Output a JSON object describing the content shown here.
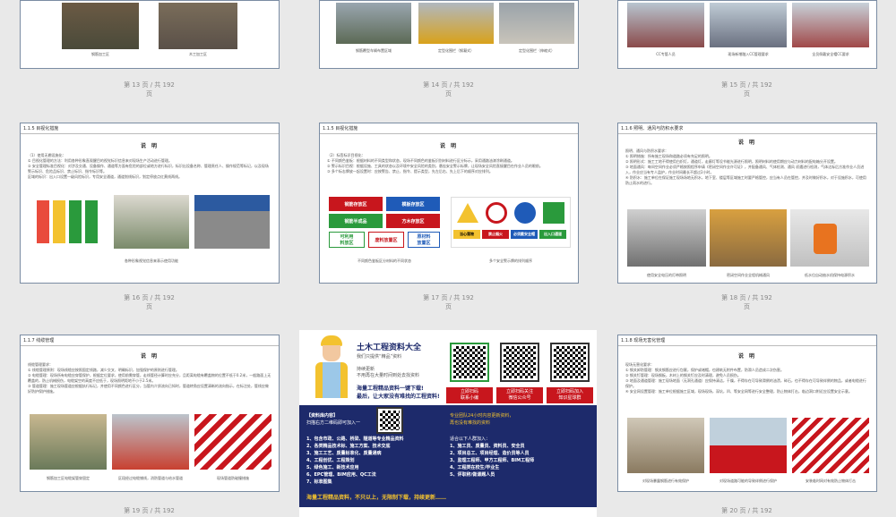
{
  "pages": {
    "p13": {
      "num": "第 13 页 / 共 192",
      "num2": "页",
      "cap1": "钢筋加工区",
      "cap2": "木工加工区"
    },
    "p14": {
      "num": "第 14 页 / 共 192",
      "num2": "页",
      "cap1": "钢筋覆型车辆布置区域",
      "cap2": "定型化围栏（钢凝式）",
      "cap3": "定型化围栏（伸缩式）"
    },
    "p15": {
      "num": "第 15 页 / 共 192",
      "num2": "页",
      "cap1": "CC专管人员",
      "cap2": "现场新增融入CC管理要求",
      "cap3": "全员佩戴安全帽CC要求"
    },
    "p16": {
      "num": "第 16 页 / 共 192",
      "num2": "页",
      "section": "1.1.5  目视化措施",
      "title": "说  明",
      "lines": [
        "（1）使用无棚设施化：",
        "① 目视化管理的方法：利用各种形象直观醒目的视觉标识信息来对现场生产活动进行管理。",
        "② 安全管理标准目视化：对涉及交通、设备操作、通道等方面有危险的部位或地方进行标识，标识出设备名称、管理责任人、操作规范等标记，以及现场警示标识、危险品标识、禁止标识、指令标识等。",
        "区域的标识：出入口设置一级风险标识，专用安全通道，通道划线标识，划定停放点红黄线两线。"
      ],
      "cap1": "各种形象视觉信息来表示使用功能"
    },
    "p17": {
      "num": "第 17 页 / 共 192",
      "num2": "页",
      "section": "1.1.5  目视化措施",
      "title": "说  明",
      "lines": [
        "（2）标签标识目视化：",
        "① 不同颜色鉴板：根据材料的不同类型和状态，现场不同颜色的鉴板识别材料进行区分标示，采用通路油漆涂刷通道。",
        "② 警示标识目视：根据设施、工具的状态以及环境中安全风险的类别，悬挂安全警示标牌，让现场安全风险直接醒目在作业人员的眼前。",
        "③ 多个标志牌放一起设置时：应按警告、禁止、指令、提示类型，先左后右、先上后下的顺序对应排列。"
      ],
      "board": [
        "钢筋存放区",
        "模板存放区",
        "钢筋半成品",
        "方木存放区"
      ],
      "boardSub": [
        "可利用\n料放区",
        "废料放置区",
        "原材料\n放置区"
      ],
      "warn": [
        "当心落物",
        "禁止烟火",
        "必须戴安全帽",
        "出入口通道"
      ],
      "cap1": "不同颜色鉴板区分材料的不同状态",
      "cap2": "多个安全警示牌的排列顺序"
    },
    "p18": {
      "num": "第 18 页 / 共 192",
      "num2": "页",
      "section": "1.1.6  照明、通风与防积水要求",
      "title": "说  明",
      "lines": [
        "照明、通风与防积水要求：",
        "① 照明措施：所有施工现场和道路必须有充足的照明。",
        "② 照明形式：施工工地不得使用白炽灯，通道灯，走廊灯等设节能光源进行照明，照明材料的使用期应与动力材料的配电箱分开设置。",
        "③ 地面通风：每间空间作业必须严格按照程序申请《密闭空间作业许可证》，并配备通风、气体检测、通风 初遇进行检测，气体达标后方准作业人员进入，作业应当有专人监护，作业时间最长不超过2小时。",
        "④ 防积水：施工单位在保证施工现场场地无积水，地下室、楼层等区域施工时要严格管控，应当有人员在管控，并及时做好积水，对于设施积水，可使用防止雨水的进行。"
      ],
      "cap1": "使用安全电压的灯带照明",
      "cap2": "密闭空间作业全程机械通风",
      "cap3": "低水位自动抽水机保持电源积水"
    },
    "p19": {
      "num": "第 19 页 / 共 192",
      "num2": "页",
      "section": "1.1.7  线缆管理",
      "title": "说  明",
      "lines": [
        "线缆管理要求：",
        "① 线缆管理原则：现场线缆应按照固定线路，减少交叉、明确标识，加强保护的原则进行管理。",
        "② 电缆管理：现场所有电缆应穿管保护，根据定位要求，使用前需穿管，走线管径计算时应充分，且距离电缆有覆盖物的位置不低于0.2米，一般路面上无覆盖的，防止机械损伤，电缆架空的高度不应低于，现场照明距地不小于2.5米。",
        "③ 管道管理：施工现场管道应根据执行标记，并使用不同颜色进行区分，当管内介质流向已知时，管道转角应设置清晰的流向指示，在标注处，管线应做好防护保护措施。"
      ],
      "cap1": "钢筋加工区电缆架管穿固定",
      "cap2": "区段经过电缆铺线，消防管道与给水管道",
      "cap3": "现场管道防碰撞措施"
    },
    "p20": {
      "num": "第 20 页 / 共 192",
      "num2": "页",
      "section": "1.1.8  现场无害化管理",
      "title": "说  明",
      "lines": [
        "现场无害化要求：",
        "① 钢关卸防管理：钢关钢筋应进行包裹，保护或堵帽，也建筑无附件布置，防滑人员造成二次伤害。",
        "② 钢关钉管理：现场钢板，木材上的钢关钉应及时清理，避免人员损伤。",
        "③ 地面及通道管理：施工现场地面（无洞孔通道）应保持清洁，干燥，不得存在可导致滑倒的油渍，碎石，也不得存在可导致绊倒的物品，或者电缆进行保护。",
        "④ 安全网设置管理：施工单位根据施工区域，现场现场，深坑，凹、等安全网等进行安全整理，防止物体打击，临边洞口附近应设置安全示意。"
      ],
      "cap1": "对现场暴露钢筋进行有效保护",
      "cap2": "对现场道路可能的导致绊倒进行保护",
      "cap3": "安装临时网对有效防止物体打击"
    }
  },
  "ad": {
    "title": "土木工程资料大全",
    "line1": "我们只提供“精品”资料",
    "line2": "持续更新",
    "line3": "不用再在大量时间到处去找资料",
    "line4": "海量工程精品资料一键下载!",
    "line5": "最后，让大家没有难找的工程资料!",
    "btn1": "立即扫码\n联系小编",
    "btn2": "立即扫码关注\n微信公众号",
    "btn3": "立即扫码加入\n知识星球群",
    "navyTitle": "【资料库内容】",
    "navySub": "扫描右方二维码即可加入一",
    "items": [
      "1、包含市政、公路、桥梁、隧道等专业精品资料",
      "2、各类精品技术标、施工方案、技术交底",
      "3、施工工艺、质量标准化、质量通病",
      "4、工程创优、工程策划",
      "5、绿色施工、新技术应用",
      "6、EPC管理、BIM应用、QC工法",
      "7、标准图集"
    ],
    "rightTitle": "专业团队24小时内容更新资料，",
    "rightSub": "再也没有难找的资料",
    "rightHead": "适合以下人群加入：",
    "rightItems": [
      "1、施工员、质量员、资料员、安全员",
      "2、项目总工、项目经理、造价员等人员",
      "3、监理工程师、甲方工程师、BIM工程师",
      "4、工程类在校生/毕业生",
      "5、评职称/做课题人员"
    ],
    "footer": "海量工程精品资料，不只以上，无限制下载，持续更新……"
  },
  "colors": {
    "navy": "#1d2a6b",
    "red": "#c8161d",
    "green": "#2a9a3c",
    "border": "#7a8ca3"
  }
}
